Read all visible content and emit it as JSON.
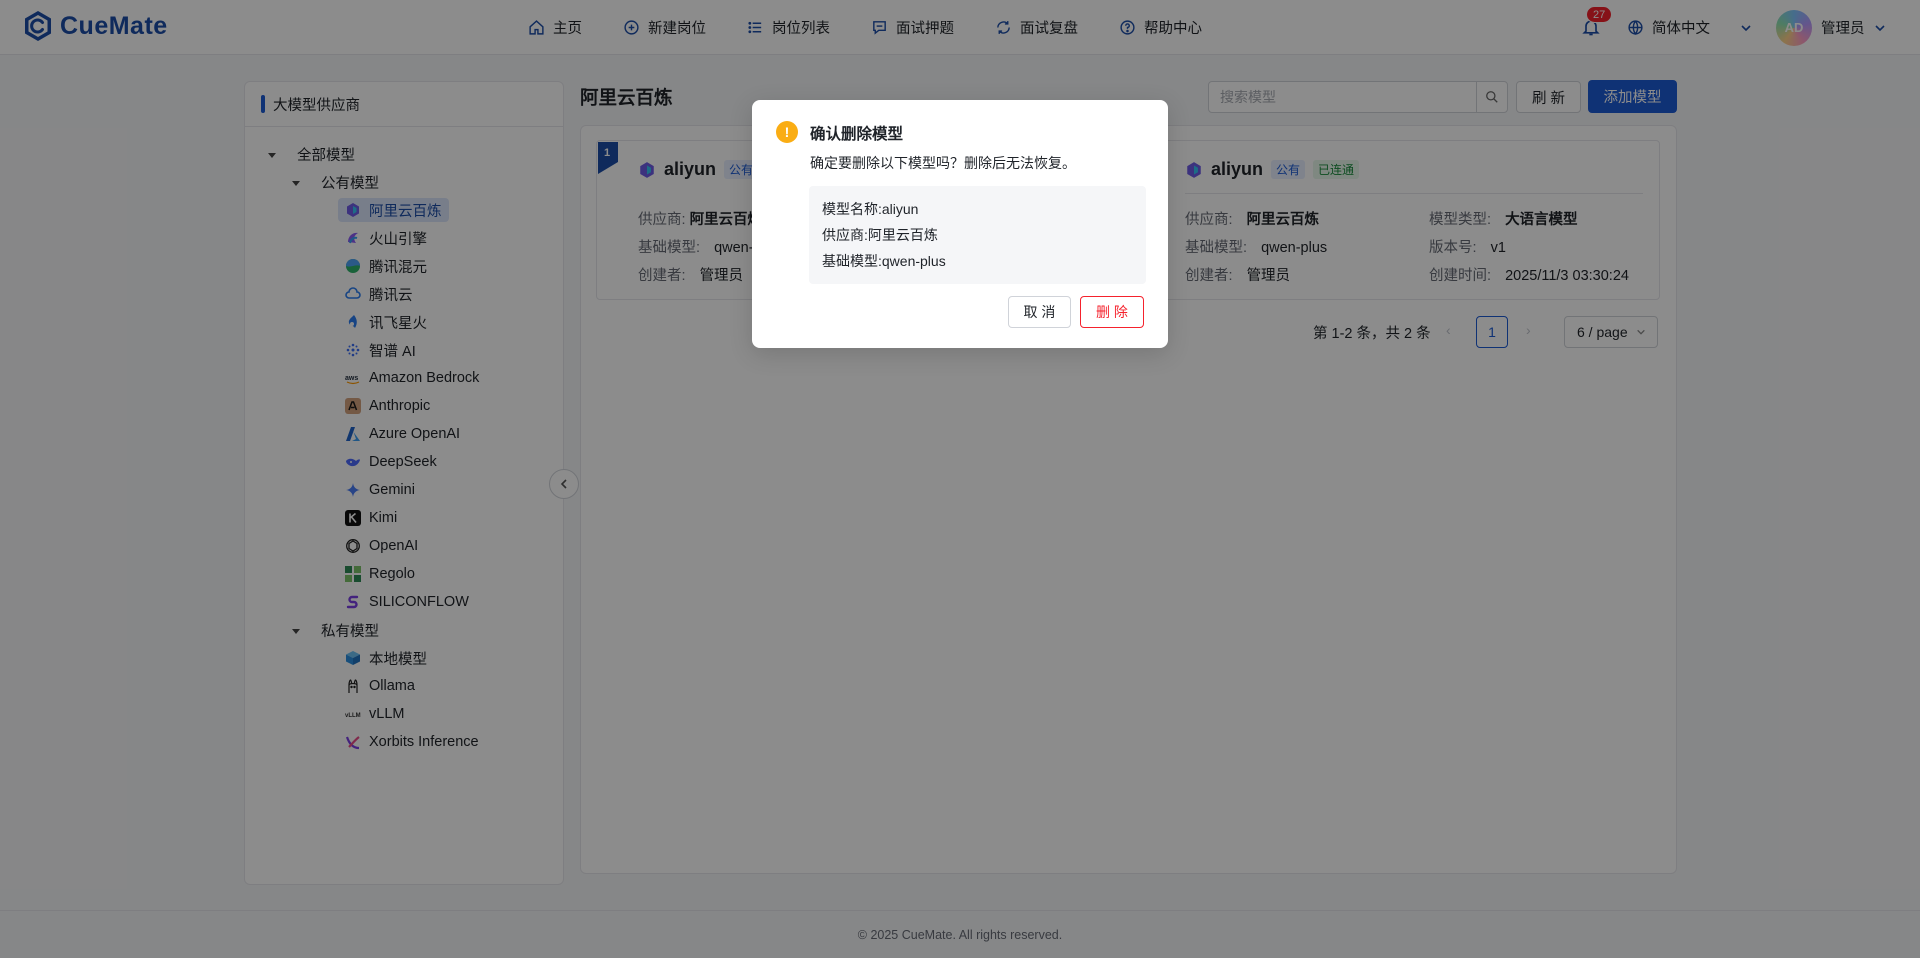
{
  "app": {
    "name": "CueMate"
  },
  "nav": {
    "items": [
      {
        "label": "主页",
        "icon": "home-icon"
      },
      {
        "label": "新建岗位",
        "icon": "plus-circle-icon"
      },
      {
        "label": "岗位列表",
        "icon": "list-icon"
      },
      {
        "label": "面试押题",
        "icon": "chat-icon"
      },
      {
        "label": "面试复盘",
        "icon": "refresh-cycle-icon"
      },
      {
        "label": "帮助中心",
        "icon": "help-icon"
      }
    ]
  },
  "header": {
    "notifications": "27",
    "language": "简体中文",
    "avatar_initials": "AD",
    "user": "管理员"
  },
  "sidebar": {
    "title": "大模型供应商",
    "root": "全部模型",
    "public_group": "公有模型",
    "public": [
      {
        "label": "阿里云百炼",
        "icon": "aliyun-icon",
        "selected": true
      },
      {
        "label": "火山引擎",
        "icon": "volcengine-icon"
      },
      {
        "label": "腾讯混元",
        "icon": "hunyuan-icon"
      },
      {
        "label": "腾讯云",
        "icon": "tencent-cloud-icon"
      },
      {
        "label": "讯飞星火",
        "icon": "spark-icon"
      },
      {
        "label": "智谱 AI",
        "icon": "zhipu-icon"
      },
      {
        "label": "Amazon Bedrock",
        "icon": "aws-icon"
      },
      {
        "label": "Anthropic",
        "icon": "anthropic-icon"
      },
      {
        "label": "Azure OpenAI",
        "icon": "azure-icon"
      },
      {
        "label": "DeepSeek",
        "icon": "deepseek-icon"
      },
      {
        "label": "Gemini",
        "icon": "gemini-icon"
      },
      {
        "label": "Kimi",
        "icon": "kimi-icon"
      },
      {
        "label": "OpenAI",
        "icon": "openai-icon"
      },
      {
        "label": "Regolo",
        "icon": "regolo-icon"
      },
      {
        "label": "SILICONFLOW",
        "icon": "siliconflow-icon"
      }
    ],
    "private_group": "私有模型",
    "private": [
      {
        "label": "本地模型",
        "icon": "cube-icon"
      },
      {
        "label": "Ollama",
        "icon": "ollama-icon"
      },
      {
        "label": "vLLM",
        "icon": "vllm-icon"
      },
      {
        "label": "Xorbits Inference",
        "icon": "xinference-icon"
      }
    ]
  },
  "main": {
    "title": "阿里云百炼",
    "search_placeholder": "搜索模型",
    "refresh": "刷 新",
    "add": "添加模型"
  },
  "cards": [
    {
      "index": "1",
      "name": "aliyun",
      "public_tag": "公有",
      "fields": {
        "provider_k": "供应商:",
        "provider_v": "阿里云百炼",
        "base_k": "基础模型:",
        "base_v": "qwen-",
        "creator_k": "创建者:",
        "creator_v": "管理员"
      }
    },
    {
      "name": "aliyun",
      "public_tag": "公有",
      "status_tag": "已连通",
      "fields": {
        "provider_k": "供应商:",
        "provider_v": "阿里云百炼",
        "type_k": "模型类型:",
        "type_v": "大语言模型",
        "base_k": "基础模型:",
        "base_v": "qwen-plus",
        "version_k": "版本号:",
        "version_v": "v1",
        "creator_k": "创建者:",
        "creator_v": "管理员",
        "time_k": "创建时间:",
        "time_v": "2025/11/3 03:30:24"
      }
    }
  ],
  "pagination": {
    "total": "第 1-2 条，共 2 条",
    "current": "1",
    "page_size": "6 / page"
  },
  "footer": "© 2025 CueMate. All rights reserved.",
  "modal": {
    "title": "确认删除模型",
    "description": "确定要删除以下模型吗？删除后无法恢复。",
    "name_k": "模型名称:",
    "name_v": "aliyun",
    "provider_k": "供应商:",
    "provider_v": "阿里云百炼",
    "base_k": "基础模型:",
    "base_v": "qwen-plus",
    "cancel": "取 消",
    "delete": "删 除"
  },
  "colors": {
    "brand": "#1d5bd6",
    "danger": "#f5222d",
    "warning": "#faad14"
  }
}
